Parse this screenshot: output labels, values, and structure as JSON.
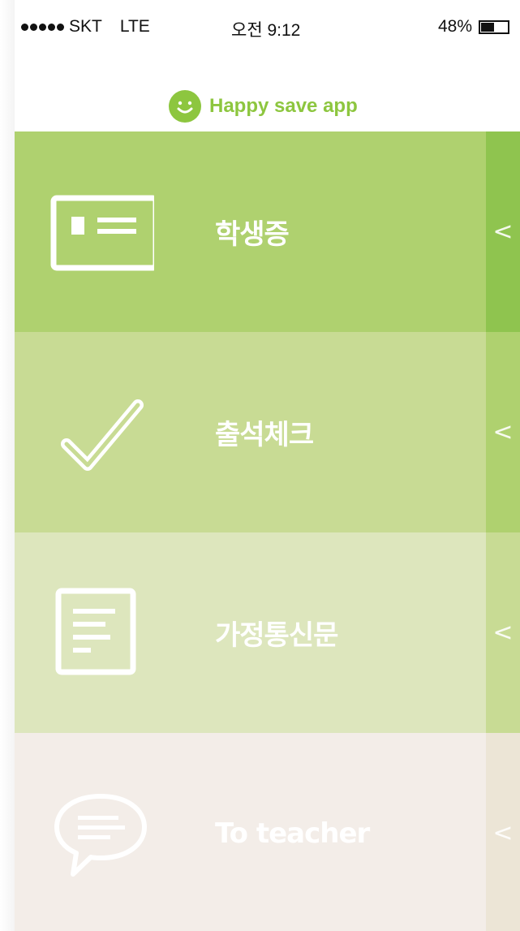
{
  "status_bar": {
    "carrier": "SKT",
    "network": "LTE",
    "time": "오전 9:12",
    "battery": "48%",
    "battery_level": 0.48
  },
  "app": {
    "brand_name": "Happy save app",
    "brand_color": "#8dc63f"
  },
  "menu": {
    "items": [
      {
        "label": "학생증",
        "icon": "id-card-icon",
        "color": "#afd16f",
        "tab_color": "#8fc44f",
        "chevron": "<"
      },
      {
        "label": "출석체크",
        "icon": "checkmark-icon",
        "color": "#c8db94",
        "tab_color": "#afd16f",
        "chevron": "<"
      },
      {
        "label": "가정통신문",
        "icon": "document-icon",
        "color": "#dde6bd",
        "tab_color": "#c8db94",
        "chevron": "<"
      },
      {
        "label": "To teacher",
        "icon": "chat-bubble-icon",
        "color": "#f3ede8",
        "tab_color": "#ece5d6",
        "chevron": "<"
      }
    ]
  }
}
